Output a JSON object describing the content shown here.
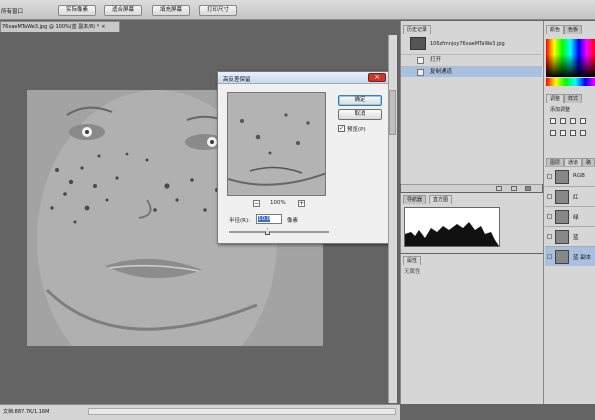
{
  "options_bar": {
    "left_label": "所有窗口",
    "buttons": [
      "实际像素",
      "适合屏幕",
      "填充屏幕",
      "打印尺寸"
    ]
  },
  "document": {
    "tab_title": "76xaeMTaWe3.jpg @ 100%(蓝 副本/8) *",
    "close": "×",
    "status": "文档:887.7K/1.16M"
  },
  "dialog": {
    "title": "高反差保留",
    "close": "×",
    "ok": "确定",
    "cancel": "取消",
    "preview_label": "预览(P)",
    "preview_checked": true,
    "zoom_minus": "−",
    "zoom_plus": "+",
    "zoom": "100%",
    "radius_label": "半径(R):",
    "radius_value": "10.0",
    "radius_unit": "像素",
    "radius_slider_level": 0.38
  },
  "history_panel": {
    "tabs": [
      "历史记录"
    ],
    "snapshot_name": "106zfmnjoy76xaeMTaWe3.jpg",
    "steps": [
      "打开",
      "复制通道"
    ],
    "selected_step": 1
  },
  "histogram_panel": {
    "tabs": [
      "导航器",
      "直方图"
    ]
  },
  "properties_panel": {
    "tab": "属性",
    "empty_text": "无属性"
  },
  "color_panel": {
    "tabs": [
      "颜色",
      "色板"
    ]
  },
  "adjustments_panel": {
    "tabs": [
      "调整",
      "样式"
    ],
    "label": "添加调整"
  },
  "channels_panel": {
    "tabs": [
      "图层",
      "通道",
      "路径"
    ],
    "channels": [
      "RGB",
      "红",
      "绿",
      "蓝",
      "蓝 副本"
    ],
    "selected": 4
  }
}
